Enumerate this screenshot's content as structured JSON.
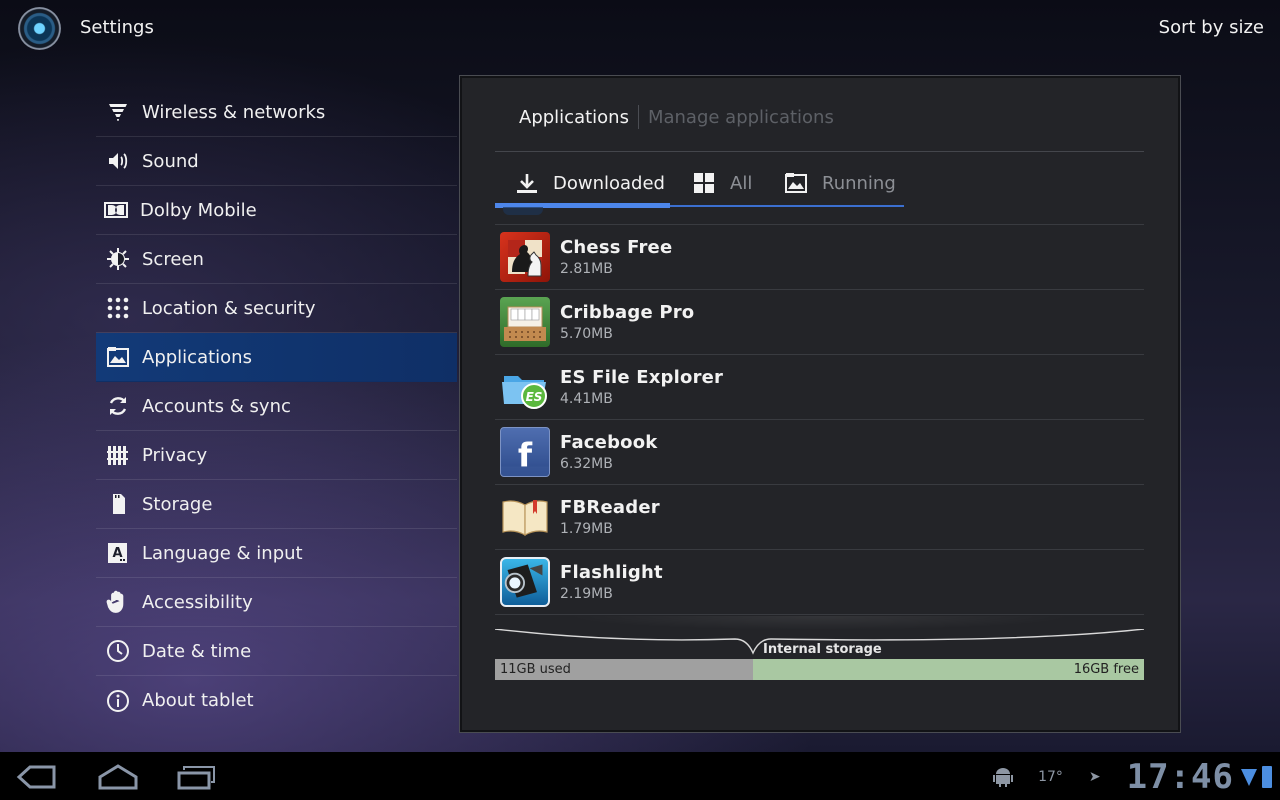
{
  "actionbar": {
    "app_icon": "settings-orb-icon",
    "title": "Settings",
    "sort_button": "Sort by size"
  },
  "menu": {
    "items": [
      {
        "label": "Wireless & networks",
        "icon": "wifi-icon"
      },
      {
        "label": "Sound",
        "icon": "speaker-icon"
      },
      {
        "label": "Dolby Mobile",
        "icon": "dolby-icon"
      },
      {
        "label": "Screen",
        "icon": "brightness-icon"
      },
      {
        "label": "Location & security",
        "icon": "location-grid-icon"
      },
      {
        "label": "Applications",
        "icon": "applications-icon",
        "selected": true
      },
      {
        "label": "Accounts & sync",
        "icon": "sync-icon"
      },
      {
        "label": "Privacy",
        "icon": "privacy-icon"
      },
      {
        "label": "Storage",
        "icon": "sdcard-icon"
      },
      {
        "label": "Language & input",
        "icon": "language-icon"
      },
      {
        "label": "Accessibility",
        "icon": "hand-icon"
      },
      {
        "label": "Date & time",
        "icon": "clock-icon"
      },
      {
        "label": "About tablet",
        "icon": "info-icon"
      }
    ]
  },
  "panel": {
    "breadcrumb": {
      "main": "Applications",
      "sub": "Manage applications"
    },
    "tabs": [
      {
        "label": "Downloaded",
        "icon": "download-icon",
        "active": true
      },
      {
        "label": "All",
        "icon": "grid-icon",
        "active": false
      },
      {
        "label": "Running",
        "icon": "running-icon",
        "active": false
      }
    ],
    "apps": [
      {
        "name": "Chess Free",
        "size": "2.81MB",
        "icon": "chess-icon"
      },
      {
        "name": "Cribbage Pro",
        "size": "5.70MB",
        "icon": "cribbage-icon"
      },
      {
        "name": "ES File Explorer",
        "size": "4.41MB",
        "icon": "es-file-explorer-icon"
      },
      {
        "name": "Facebook",
        "size": "6.32MB",
        "icon": "facebook-icon"
      },
      {
        "name": "FBReader",
        "size": "1.79MB",
        "icon": "book-icon"
      },
      {
        "name": "Flashlight",
        "size": "2.19MB",
        "icon": "flashlight-icon"
      }
    ],
    "storage": {
      "label": "Internal storage",
      "used": "11GB used",
      "free": "16GB free"
    }
  },
  "systembar": {
    "temperature": "17°",
    "time": "17:46",
    "nav": [
      "back-icon",
      "home-icon",
      "recent-apps-icon"
    ]
  },
  "colors": {
    "selected_item": "#123a78",
    "tab_indicator": "#4d86ea",
    "storage_used": "#a0a0a0",
    "storage_free": "#a9c8a2"
  }
}
